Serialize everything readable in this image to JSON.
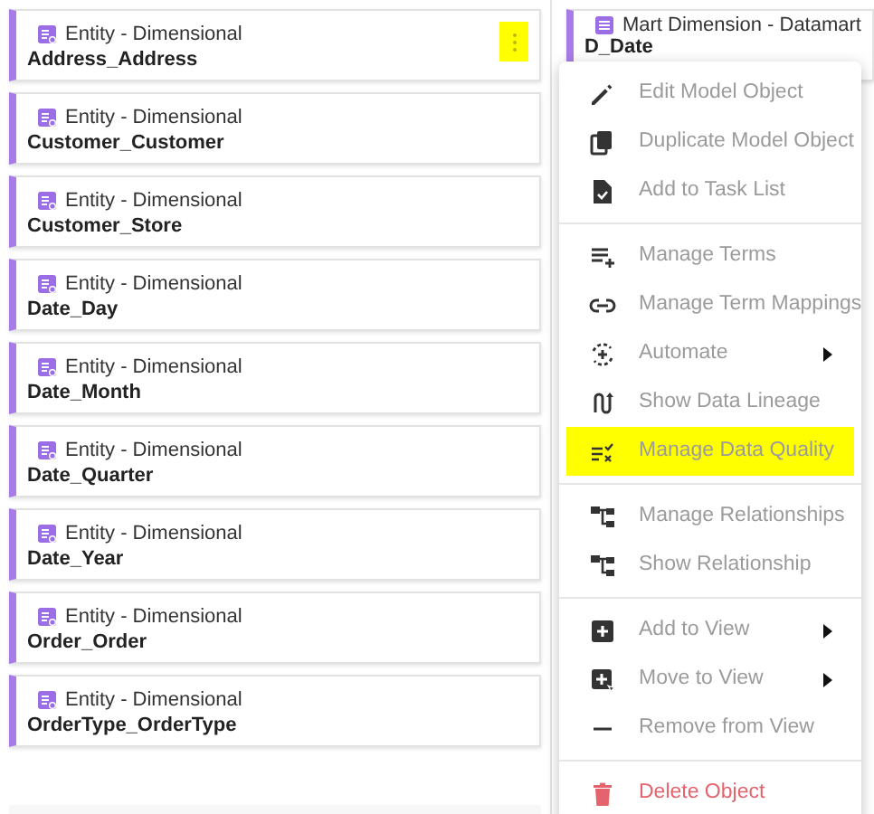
{
  "cards": [
    {
      "type": "Entity - Dimensional",
      "name": "Address_Address",
      "menu_open": true
    },
    {
      "type": "Entity - Dimensional",
      "name": "Customer_Customer",
      "menu_open": false
    },
    {
      "type": "Entity - Dimensional",
      "name": "Customer_Store",
      "menu_open": false
    },
    {
      "type": "Entity - Dimensional",
      "name": "Date_Day",
      "menu_open": false
    },
    {
      "type": "Entity - Dimensional",
      "name": "Date_Month",
      "menu_open": false
    },
    {
      "type": "Entity - Dimensional",
      "name": "Date_Quarter",
      "menu_open": false
    },
    {
      "type": "Entity - Dimensional",
      "name": "Date_Year",
      "menu_open": false
    },
    {
      "type": "Entity - Dimensional",
      "name": "Order_Order",
      "menu_open": false
    },
    {
      "type": "Entity - Dimensional",
      "name": "OrderType_OrderType",
      "menu_open": false
    }
  ],
  "right_cards": [
    {
      "type": "Mart Dimension - Datamart",
      "name": "D_Date"
    }
  ],
  "menu": {
    "groups": [
      [
        {
          "label": "Edit Model Object",
          "kind": "normal",
          "submenu": false,
          "selected": false
        },
        {
          "label": "Duplicate Model Object",
          "kind": "normal",
          "submenu": false,
          "selected": false
        },
        {
          "label": "Add to Task List",
          "kind": "normal",
          "submenu": false,
          "selected": false
        }
      ],
      [
        {
          "label": "Manage Terms",
          "kind": "normal",
          "submenu": false,
          "selected": false
        },
        {
          "label": "Manage Term Mappings",
          "kind": "normal",
          "submenu": false,
          "selected": false
        },
        {
          "label": "Automate",
          "kind": "normal",
          "submenu": true,
          "selected": false
        },
        {
          "label": "Show Data Lineage",
          "kind": "normal",
          "submenu": false,
          "selected": false
        },
        {
          "label": "Manage Data Quality",
          "kind": "normal",
          "submenu": false,
          "selected": true
        }
      ],
      [
        {
          "label": "Manage Relationships",
          "kind": "normal",
          "submenu": false,
          "selected": false
        },
        {
          "label": "Show Relationship",
          "kind": "normal",
          "submenu": false,
          "selected": false
        }
      ],
      [
        {
          "label": "Add to View",
          "kind": "normal",
          "submenu": true,
          "selected": false
        },
        {
          "label": "Move to View",
          "kind": "normal",
          "submenu": true,
          "selected": false
        },
        {
          "label": "Remove from View",
          "kind": "normal",
          "submenu": false,
          "selected": false
        }
      ],
      [
        {
          "label": "Delete Object",
          "kind": "danger",
          "submenu": false,
          "selected": false
        }
      ]
    ]
  }
}
